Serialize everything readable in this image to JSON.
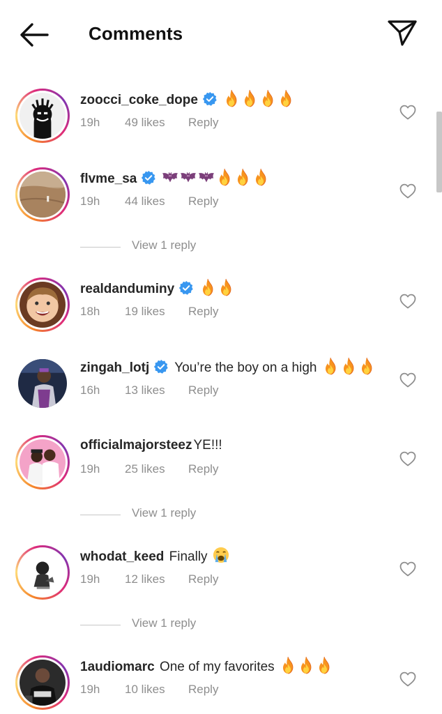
{
  "header": {
    "title": "Comments",
    "back_icon": "arrow-left-icon",
    "send_icon": "paper-plane-icon"
  },
  "colors": {
    "verified_blue": "#3897f0",
    "meta_gray": "#8e8e8e",
    "ring_gradient": [
      "#f58529",
      "#feda77",
      "#dd2a7b",
      "#8134af"
    ]
  },
  "comments": [
    {
      "username": "zoocci_coke_dope",
      "verified": true,
      "text": "",
      "emojis": [
        "fire",
        "fire",
        "fire",
        "fire"
      ],
      "time": "19h",
      "likes": "49 likes",
      "reply": "Reply"
    },
    {
      "username": "flvme_sa",
      "verified": true,
      "text": "",
      "emojis": [
        "bat",
        "bat",
        "bat",
        "fire",
        "fire",
        "fire"
      ],
      "time": "19h",
      "likes": "44 likes",
      "reply": "Reply",
      "view_replies": "View 1 reply"
    },
    {
      "username": "realdanduminy",
      "verified": true,
      "text": "",
      "emojis": [
        "fire",
        "fire"
      ],
      "time": "18h",
      "likes": "19 likes",
      "reply": "Reply"
    },
    {
      "username": "zingah_lotj",
      "verified": true,
      "text": "You’re the boy on a high",
      "emojis": [
        "fire",
        "fire",
        "fire"
      ],
      "time": "16h",
      "likes": "13 likes",
      "reply": "Reply"
    },
    {
      "username": "officialmajorsteez",
      "verified": false,
      "text": "YE!!!",
      "emojis": [],
      "time": "19h",
      "likes": "25 likes",
      "reply": "Reply",
      "view_replies": "View 1 reply"
    },
    {
      "username": "whodat_keed",
      "verified": false,
      "text": "Finally",
      "emojis": [
        "crying-face"
      ],
      "time": "19h",
      "likes": "12 likes",
      "reply": "Reply",
      "view_replies": "View 1 reply"
    },
    {
      "username": "1audiomarc",
      "verified": false,
      "text": "One of my favorites",
      "emojis": [
        "fire",
        "fire",
        "fire"
      ],
      "time": "19h",
      "likes": "10 likes",
      "reply": "Reply"
    }
  ]
}
